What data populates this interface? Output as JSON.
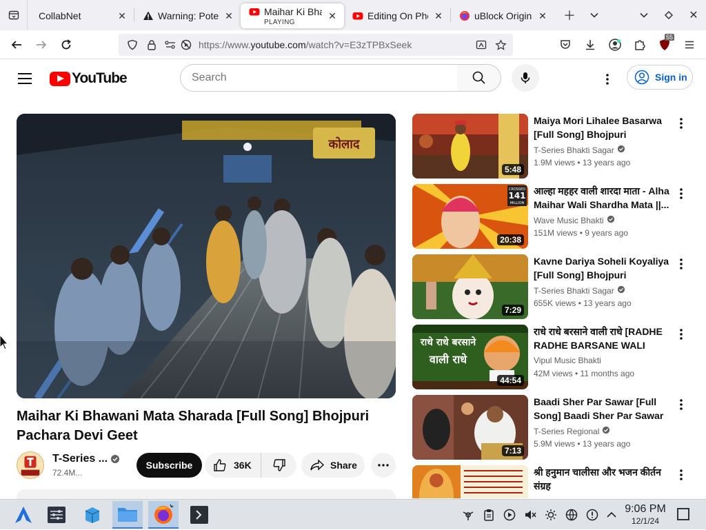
{
  "browser": {
    "tabs": [
      {
        "title": "CollabNet",
        "playing": ""
      },
      {
        "title": "Warning: Poter",
        "playing": ""
      },
      {
        "title": "Maihar Ki Bhav",
        "playing": "PLAYING"
      },
      {
        "title": "Editing On Pho",
        "playing": ""
      },
      {
        "title": "uBlock Origin -",
        "playing": ""
      }
    ],
    "url_prefix": "https://www.",
    "url_domain": "youtube.com",
    "url_path": "/watch?v=E3zTPBxSeek",
    "extension_badge": "55"
  },
  "youtube": {
    "logo_text": "YouTube",
    "search_placeholder": "Search",
    "sign_in": "Sign in",
    "accent": "#ff0000",
    "link_color": "#065fd4"
  },
  "video": {
    "title": "Maihar Ki Bhawani Mata Sharada [Full Song] Bhojpuri Pachara Devi Geet",
    "channel": "T-Series ...",
    "subscribers": "72.4M...",
    "subscribe_label": "Subscribe",
    "likes": "36K",
    "share_label": "Share",
    "scene_sign_text": "कोलाद"
  },
  "recommendations": [
    {
      "title": "Maiya Mori Lihalee Basarwa [Full Song] Bhojpuri Pachara...",
      "channel": "T-Series Bhakti Sagar",
      "verified": true,
      "meta": "1.9M views • 13 years ago",
      "duration": "5:48"
    },
    {
      "title": "आल्हा महहर वाली शारदा माता - Alha Maihar Wali Shardha Mata ||...",
      "channel": "Wave Music Bhakti",
      "verified": true,
      "meta": "151M views • 9 years ago",
      "duration": "20:38"
    },
    {
      "title": "Kavne Dariya Soheli Koyaliya [Full Song] Bhojpuri Pachara...",
      "channel": "T-Series Bhakti Sagar",
      "verified": true,
      "meta": "655K views • 13 years ago",
      "duration": "7:29"
    },
    {
      "title": "राधे राधे बरसाने वाली राधे [RADHE RADHE BARSANE WALI RADH...",
      "channel": "Vipul Music Bhakti",
      "verified": false,
      "meta": "42M views • 11 months ago",
      "duration": "44:54"
    },
    {
      "title": "Baadi Sher Par Sawar [Full Song] Baadi Sher Par Sawar",
      "channel": "T-Series Regional",
      "verified": true,
      "meta": "5.9M views • 13 years ago",
      "duration": "7:13"
    },
    {
      "title": "श्री हनुमान चालीसा और भजन कीर्तन संग्रह",
      "channel": "",
      "verified": false,
      "meta": "",
      "duration": ""
    }
  ],
  "thumb_text": {
    "crossed": "CROSSED",
    "crossed_num": "141",
    "million": "MILLION",
    "radhe_line1": "राधे राधे बरसाने",
    "radhe_line2": "वाली राधे"
  },
  "taskbar": {
    "time": "9:06 PM",
    "date": "12/1/24"
  }
}
